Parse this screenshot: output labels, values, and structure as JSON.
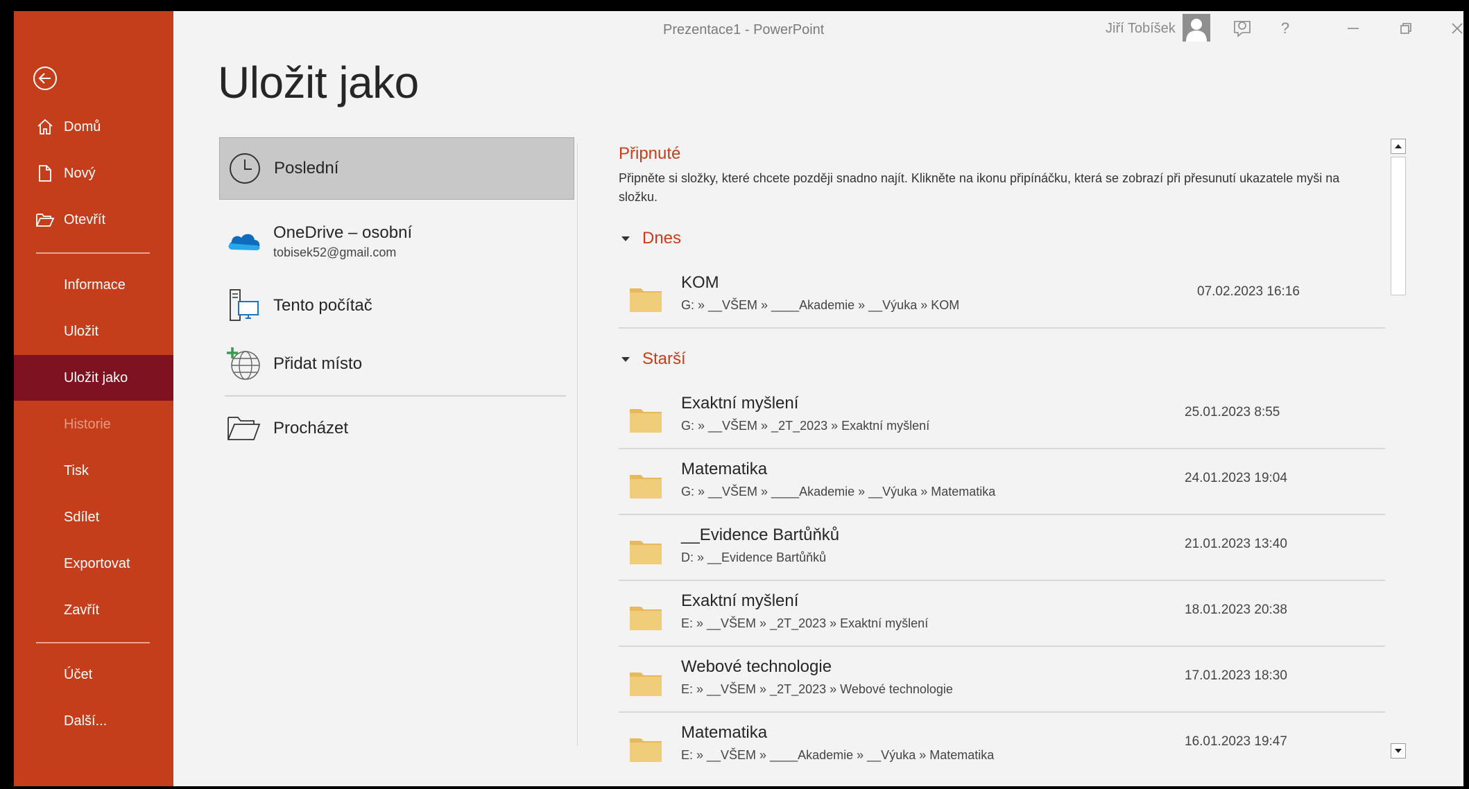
{
  "titlebar": {
    "title": "Prezentace1  -  PowerPoint",
    "user_name": "Jiří Tobíšek"
  },
  "sidebar": {
    "items": [
      {
        "label": "Domů",
        "icon": "home-icon"
      },
      {
        "label": "Nový",
        "icon": "new-document-icon"
      },
      {
        "label": "Otevřít",
        "icon": "open-folder-icon"
      },
      {
        "label": "Informace"
      },
      {
        "label": "Uložit"
      },
      {
        "label": "Uložit jako",
        "active": true
      },
      {
        "label": "Historie",
        "disabled": true
      },
      {
        "label": "Tisk"
      },
      {
        "label": "Sdílet"
      },
      {
        "label": "Exportovat"
      },
      {
        "label": "Zavřít"
      },
      {
        "label": "Účet"
      },
      {
        "label": "Další..."
      }
    ]
  },
  "main": {
    "title": "Uložit jako",
    "locations": [
      {
        "name": "Poslední",
        "icon": "clock-icon",
        "selected": true
      },
      {
        "name": "OneDrive – osobní",
        "sub": "tobisek52@gmail.com",
        "icon": "onedrive-cloud-icon"
      },
      {
        "name": "Tento počítač",
        "icon": "computer-icon"
      },
      {
        "name": "Přidat místo",
        "icon": "add-place-globe-icon"
      },
      {
        "name": "Procházet",
        "icon": "browse-folder-icon"
      }
    ]
  },
  "recent": {
    "pinned_title": "Připnuté",
    "pinned_desc": "Připněte si složky, které chcete později snadno najít. Klikněte na ikonu připínáčku, která se zobrazí při přesunutí ukazatele myši na složku.",
    "today_label": "Dnes",
    "older_label": "Starší",
    "today": [
      {
        "name": "KOM",
        "path": "G: » __VŠEM » ____Akademie » __Výuka » KOM",
        "date": "07.02.2023 16:16"
      }
    ],
    "older": [
      {
        "name": "Exaktní myšlení",
        "path": "G: » __VŠEM » _2T_2023 » Exaktní myšlení",
        "date": "25.01.2023 8:55"
      },
      {
        "name": "Matematika",
        "path": "G: » __VŠEM » ____Akademie » __Výuka » Matematika",
        "date": "24.01.2023 19:04"
      },
      {
        "name": "__Evidence Bartůňků",
        "path": "D: » __Evidence Bartůňků",
        "date": "21.01.2023 13:40"
      },
      {
        "name": "Exaktní myšlení",
        "path": "E: » __VŠEM » _2T_2023 » Exaktní myšlení",
        "date": "18.01.2023 20:38"
      },
      {
        "name": "Webové technologie",
        "path": "E: » __VŠEM » _2T_2023 » Webové technologie",
        "date": "17.01.2023 18:30"
      },
      {
        "name": "Matematika",
        "path": "E: » __VŠEM » ____Akademie » __Výuka » Matematika",
        "date": "16.01.2023 19:47"
      }
    ]
  },
  "colors": {
    "accent": "#c43e1c",
    "sidebar_active": "#7e1220",
    "folder": "#f0cd7a"
  }
}
